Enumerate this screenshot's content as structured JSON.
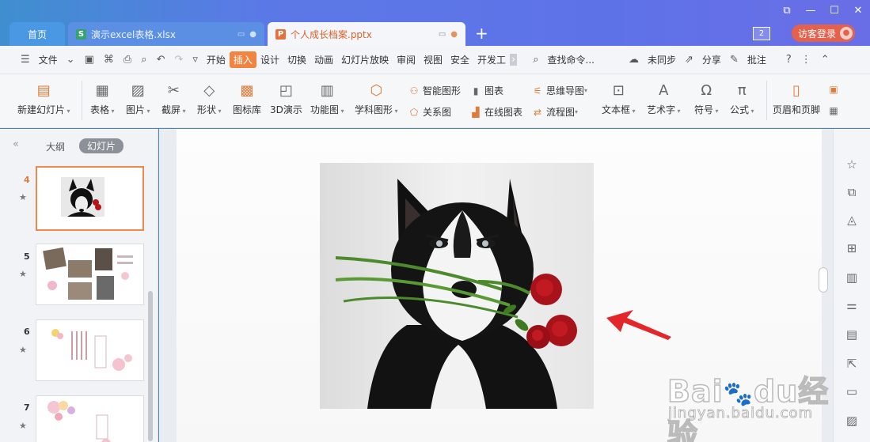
{
  "titlebar": {
    "tabs": [
      {
        "label": "首页"
      },
      {
        "label": "演示excel表格.xlsx",
        "icon": "S"
      },
      {
        "label": "个人成长档案.pptx",
        "icon": "P"
      }
    ],
    "window_count": "2",
    "login_label": "访客登录"
  },
  "menubar": {
    "file_label": "文件",
    "tabs": [
      "开始",
      "插入",
      "设计",
      "切换",
      "动画",
      "幻灯片放映",
      "审阅",
      "视图",
      "安全",
      "开发工"
    ],
    "active_tab": "插入",
    "search_label": "查找命令...",
    "sync_label": "未同步",
    "share_label": "分享",
    "comment_label": "批注"
  },
  "ribbon": {
    "new_slide": "新建幻灯片",
    "table": "表格",
    "picture": "图片",
    "screenshot": "截屏",
    "shape": "形状",
    "icon_lib": "图标库",
    "demo3d": "3D演示",
    "func_chart": "功能图",
    "subject_chart": "学科图形",
    "smart_shape": "智能图形",
    "chart": "图表",
    "relation_chart": "关系图",
    "online_chart": "在线图表",
    "mind_map": "思维导图",
    "flow_chart": "流程图",
    "textbox": "文本框",
    "wordart": "艺术字",
    "symbol": "符号",
    "formula": "公式",
    "header_footer": "页眉和页脚",
    "icon_3d": "3D"
  },
  "leftpanel": {
    "tab_outline": "大纲",
    "tab_slides": "幻灯片",
    "slides": [
      "4",
      "5",
      "6",
      "7"
    ],
    "current_slide": "4"
  },
  "watermark": {
    "brand": "Bai",
    "brand_paw": "du",
    "brand_cn": "经验",
    "url": "jingyan.baidu.com"
  },
  "colors": {
    "accent": "#f08542",
    "titlebar": "#5b79e6",
    "arrow": "#e2262a"
  }
}
